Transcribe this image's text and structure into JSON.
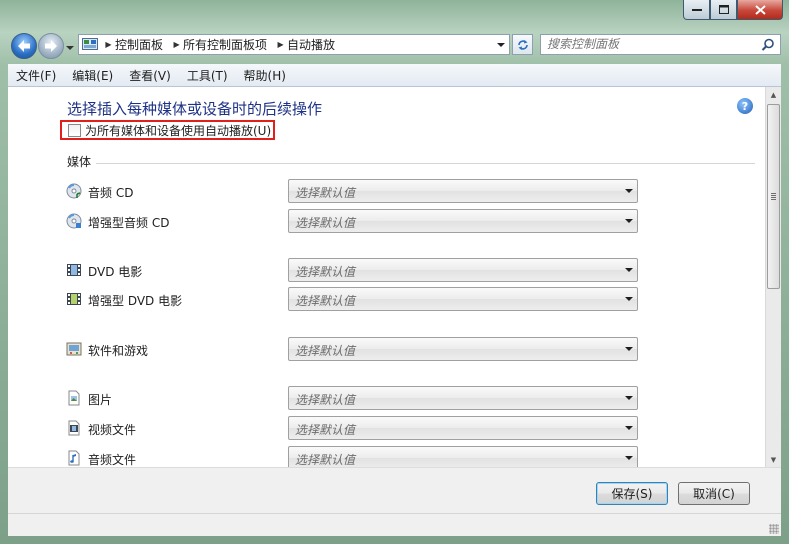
{
  "window": {
    "minimize_icon": "minimize-icon",
    "maximize_icon": "maximize-icon",
    "close_icon": "close-icon"
  },
  "navigation": {
    "back_icon": "back-arrow-icon",
    "forward_icon": "forward-arrow-icon",
    "breadcrumbs": [
      "控制面板",
      "所有控制面板项",
      "自动播放"
    ],
    "search_placeholder": "搜索控制面板"
  },
  "menu": [
    {
      "label": "文件(F)"
    },
    {
      "label": "编辑(E)"
    },
    {
      "label": "查看(V)"
    },
    {
      "label": "工具(T)"
    },
    {
      "label": "帮助(H)"
    }
  ],
  "main": {
    "heading": "选择插入每种媒体或设备时的后续操作",
    "autoplay_checkbox": {
      "label": "为所有媒体和设备使用自动播放(U)",
      "checked": false
    },
    "section_media": "媒体",
    "default_select_text": "选择默认值",
    "rows": [
      {
        "label": "音频 CD",
        "icon": "audio-cd-icon",
        "value": "选择默认值"
      },
      {
        "label": "增强型音频 CD",
        "icon": "enhanced-audio-cd-icon",
        "value": "选择默认值"
      },
      {
        "label": "DVD 电影",
        "icon": "dvd-movie-icon",
        "value": "选择默认值"
      },
      {
        "label": "增强型 DVD 电影",
        "icon": "enhanced-dvd-icon",
        "value": "选择默认值"
      },
      {
        "label": "软件和游戏",
        "icon": "software-games-icon",
        "value": "选择默认值"
      },
      {
        "label": "图片",
        "icon": "pictures-icon",
        "value": "选择默认值"
      },
      {
        "label": "视频文件",
        "icon": "video-file-icon",
        "value": "选择默认值"
      },
      {
        "label": "音频文件",
        "icon": "audio-file-icon",
        "value": "选择默认值"
      }
    ]
  },
  "footer": {
    "save_label": "保存(S)",
    "cancel_label": "取消(C)"
  },
  "colors": {
    "heading": "#1e3287",
    "highlight_border": "#e0201a"
  }
}
